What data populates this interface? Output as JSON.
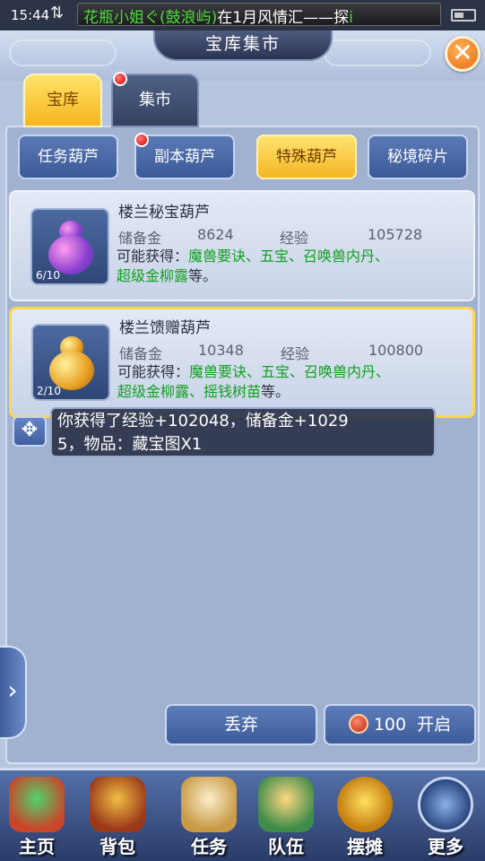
{
  "status_bar": {
    "time": "15:44",
    "arrows": "⇅",
    "marquee_green": "花瓶小姐ぐ(鼓浪屿)",
    "marquee_white": "在1月风情汇——探",
    "marquee_tail": "i"
  },
  "header": {
    "title": "宝库集市",
    "close_label": "✕"
  },
  "tabs": [
    {
      "label": "宝库",
      "active": true
    },
    {
      "label": "集市",
      "active": false
    }
  ],
  "categories": [
    {
      "label": "任务葫芦"
    },
    {
      "label": "副本葫芦"
    },
    {
      "label": "特殊葫芦"
    },
    {
      "label": "秘境碎片"
    }
  ],
  "items": [
    {
      "name": "楼兰秘宝葫芦",
      "count": "6/10",
      "reserve_label": "储备金",
      "reserve_value": "8624",
      "exp_label": "经验",
      "exp_value": "105728",
      "drop_prefix": "可能获得：",
      "drop_line1": "魔兽要诀、五宝、召唤兽内丹、",
      "drop_line2": "超级金柳露",
      "drop_suffix": "等。"
    },
    {
      "name": "楼兰馈赠葫芦",
      "count": "2/10",
      "reserve_label": "储备金",
      "reserve_value": "10348",
      "exp_label": "经验",
      "exp_value": "100800",
      "drop_prefix": "可能获得：",
      "drop_line1": "魔兽要诀、五宝、召唤兽内丹、",
      "drop_line2": "超级金柳露、摇钱树苗",
      "drop_suffix": "等。"
    }
  ],
  "notification": {
    "line1": "你获得了经验+102048，储备金+1029",
    "line2": "5，物品：藏宝图X1"
  },
  "actions": {
    "discard_label": "丢弃",
    "open_cost": "100",
    "open_label": "开启"
  },
  "nav": [
    {
      "label": "主页"
    },
    {
      "label": "背包"
    },
    {
      "label": "任务"
    },
    {
      "label": "队伍"
    },
    {
      "label": "摆摊"
    },
    {
      "label": "更多"
    }
  ]
}
